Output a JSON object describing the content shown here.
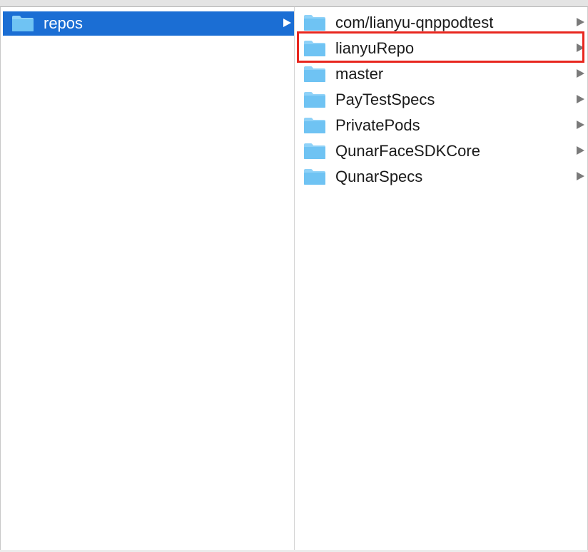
{
  "colors": {
    "selection": "#1b6ed4",
    "folder_body": "#6fc3f3",
    "folder_tab": "#8fd2f8",
    "disclosure_arrow": "#7a7a7a",
    "annotation": "#e8271f"
  },
  "columns": [
    {
      "items": [
        {
          "label": "repos",
          "icon": "folder-icon",
          "selected": true,
          "has_children": true
        }
      ]
    },
    {
      "items": [
        {
          "label": "com/lianyu-qnppodtest",
          "icon": "folder-icon",
          "has_children": true
        },
        {
          "label": "lianyuRepo",
          "icon": "folder-icon",
          "has_children": true,
          "annotated": true
        },
        {
          "label": "master",
          "icon": "folder-icon",
          "has_children": true
        },
        {
          "label": "PayTestSpecs",
          "icon": "folder-icon",
          "has_children": true
        },
        {
          "label": "PrivatePods",
          "icon": "folder-icon",
          "has_children": true
        },
        {
          "label": "QunarFaceSDKCore",
          "icon": "folder-icon",
          "has_children": true
        },
        {
          "label": "QunarSpecs",
          "icon": "folder-icon",
          "has_children": true
        }
      ]
    }
  ]
}
